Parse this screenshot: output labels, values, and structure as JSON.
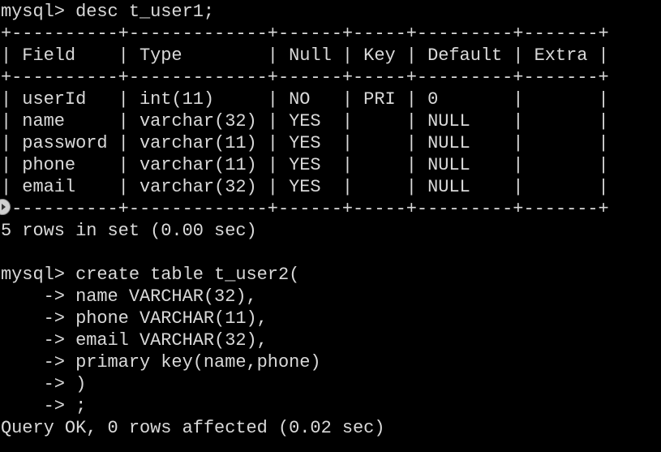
{
  "terminal": {
    "lines": [
      "mysql> desc t_user1;",
      "+----------+-------------+------+-----+---------+-------+",
      "| Field    | Type        | Null | Key | Default | Extra |",
      "+----------+-------------+------+-----+---------+-------+",
      "| userId   | int(11)     | NO   | PRI | 0       |       |",
      "| name     | varchar(32) | YES  |     | NULL    |       |",
      "| password | varchar(11) | YES  |     | NULL    |       |",
      "| phone    | varchar(11) | YES  |     | NULL    |       |",
      "| email    | varchar(32) | YES  |     | NULL    |       |",
      "+----------+-------------+------+-----+---------+-------+",
      "5 rows in set (0.00 sec)",
      "",
      "mysql> create table t_user2(",
      "    -> name VARCHAR(32),",
      "    -> phone VARCHAR(11),",
      "    -> email VARCHAR(32),",
      "    -> primary key(name,phone)",
      "    -> )",
      "    -> ;",
      "Query OK, 0 rows affected (0.02 sec)"
    ]
  },
  "colors": {
    "background": "#000000",
    "text": "#d9d9d9"
  },
  "icons": {
    "scroll_handle": "scroll-arrow-icon"
  }
}
